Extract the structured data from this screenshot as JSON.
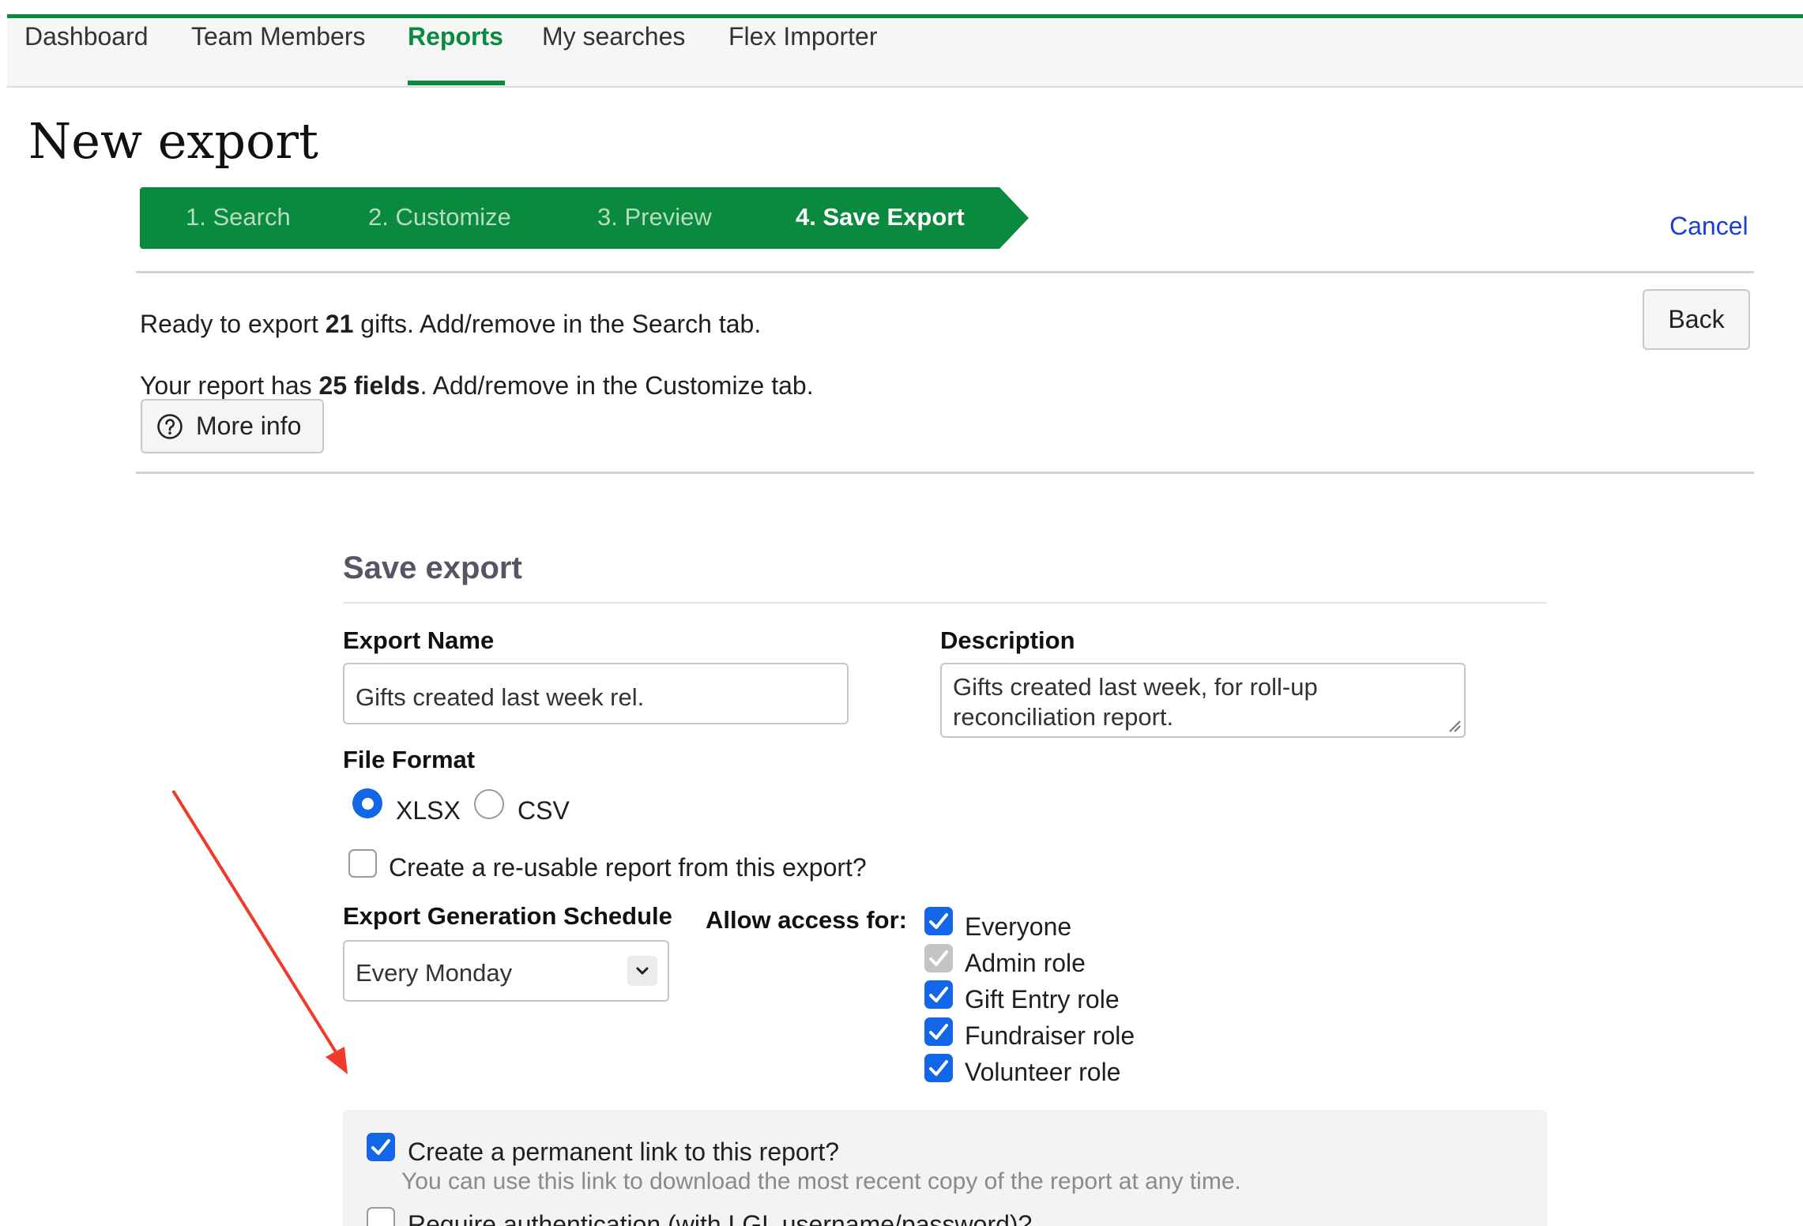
{
  "nav": {
    "items": [
      "Dashboard",
      "Team Members",
      "Reports",
      "My searches",
      "Flex Importer"
    ],
    "active": "Reports"
  },
  "page": {
    "title": "New export"
  },
  "wizard": {
    "steps": [
      "1. Search",
      "2. Customize",
      "3. Preview",
      "4. Save Export"
    ],
    "current": "4. Save Export",
    "cancel_label": "Cancel"
  },
  "summary": {
    "gifts_prefix": "Ready to export ",
    "gifts_count": "21",
    "gifts_suffix": " gifts. Add/remove in the Search tab.",
    "fields_prefix": "Your report has ",
    "fields_count": "25 fields",
    "fields_suffix": ". Add/remove in the Customize tab.",
    "back_label": "Back",
    "more_info_label": "More info"
  },
  "form": {
    "section_title": "Save export",
    "export_name_label": "Export Name",
    "export_name_value": "Gifts created last week rel.",
    "description_label": "Description",
    "description_value": "Gifts created last week, for roll-up reconciliation report.",
    "file_format_label": "File Format",
    "file_formats": [
      {
        "label": "XLSX",
        "selected": true
      },
      {
        "label": "CSV",
        "selected": false
      }
    ],
    "reusable_label": "Create a re-usable report from this export?",
    "reusable_checked": false,
    "schedule_label": "Export Generation Schedule",
    "schedule_value": "Every Monday",
    "access_label": "Allow access for:",
    "access_options": [
      {
        "label": "Everyone",
        "state": "checked"
      },
      {
        "label": "Admin role",
        "state": "checked-disabled"
      },
      {
        "label": "Gift Entry role",
        "state": "checked"
      },
      {
        "label": "Fundraiser role",
        "state": "checked"
      },
      {
        "label": "Volunteer role",
        "state": "checked"
      }
    ],
    "permalink_label": "Create a permanent link to this report?",
    "permalink_checked": true,
    "permalink_hint": "You can use this link to download the most recent copy of the report at any time.",
    "auth_label": "Require authentication (with LGL username/password)?",
    "auth_checked": false
  },
  "colors": {
    "brand_green": "#0a8a3e",
    "checkbox_blue": "#1466e8",
    "link_blue": "#1a3fd6",
    "annotation_red": "#f03a2a"
  }
}
